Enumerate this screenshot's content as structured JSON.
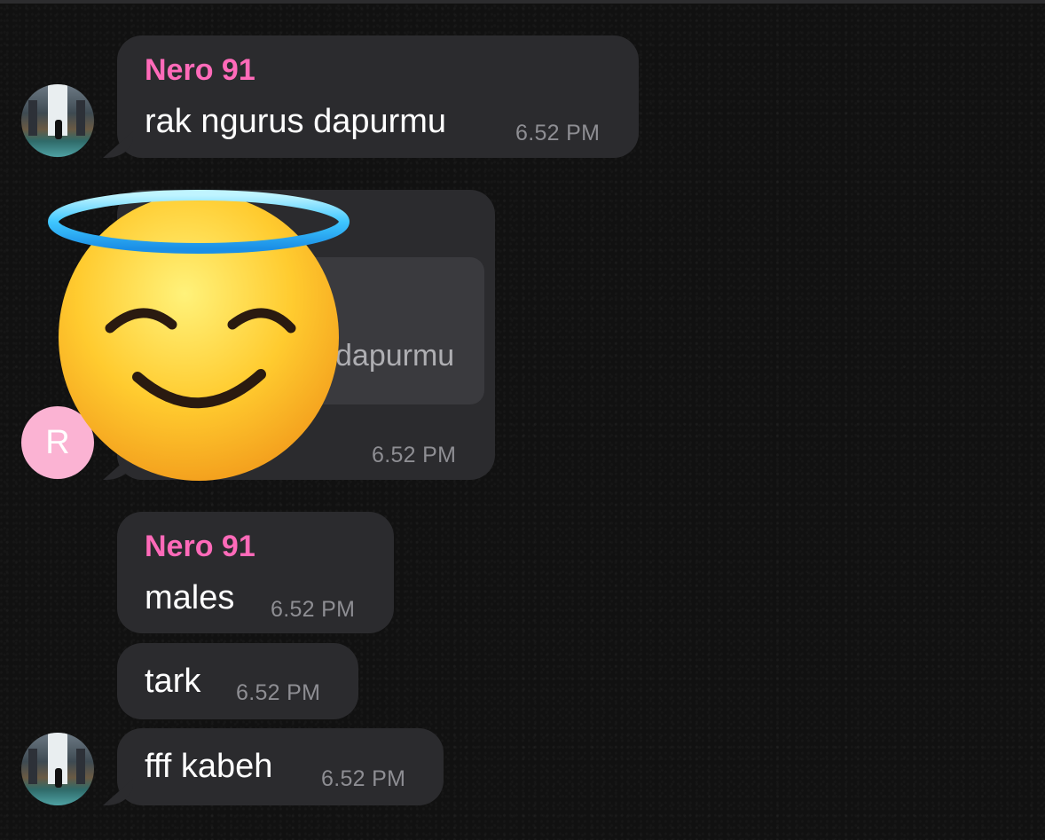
{
  "messages": [
    {
      "sender": "Nero 91",
      "text": "rak ngurus dapurmu",
      "time": "6.52 PM"
    },
    {
      "reply_text": "dapurmu",
      "time": "6.52 PM",
      "avatar_letter": "R"
    },
    {
      "sender": "Nero 91",
      "text": "males",
      "time": "6.52 PM"
    },
    {
      "text": "tark",
      "time": "6.52 PM"
    },
    {
      "text": "fff kabeh",
      "time": "6.52 PM"
    }
  ],
  "colors": {
    "sender_name": "#ff6ab9",
    "bubble": "#2b2b2e",
    "timestamp": "#8e8e93",
    "avatar_letter_bg": "#fbb3d3"
  },
  "sticker": {
    "icon": "smiling-face-with-halo-icon"
  }
}
